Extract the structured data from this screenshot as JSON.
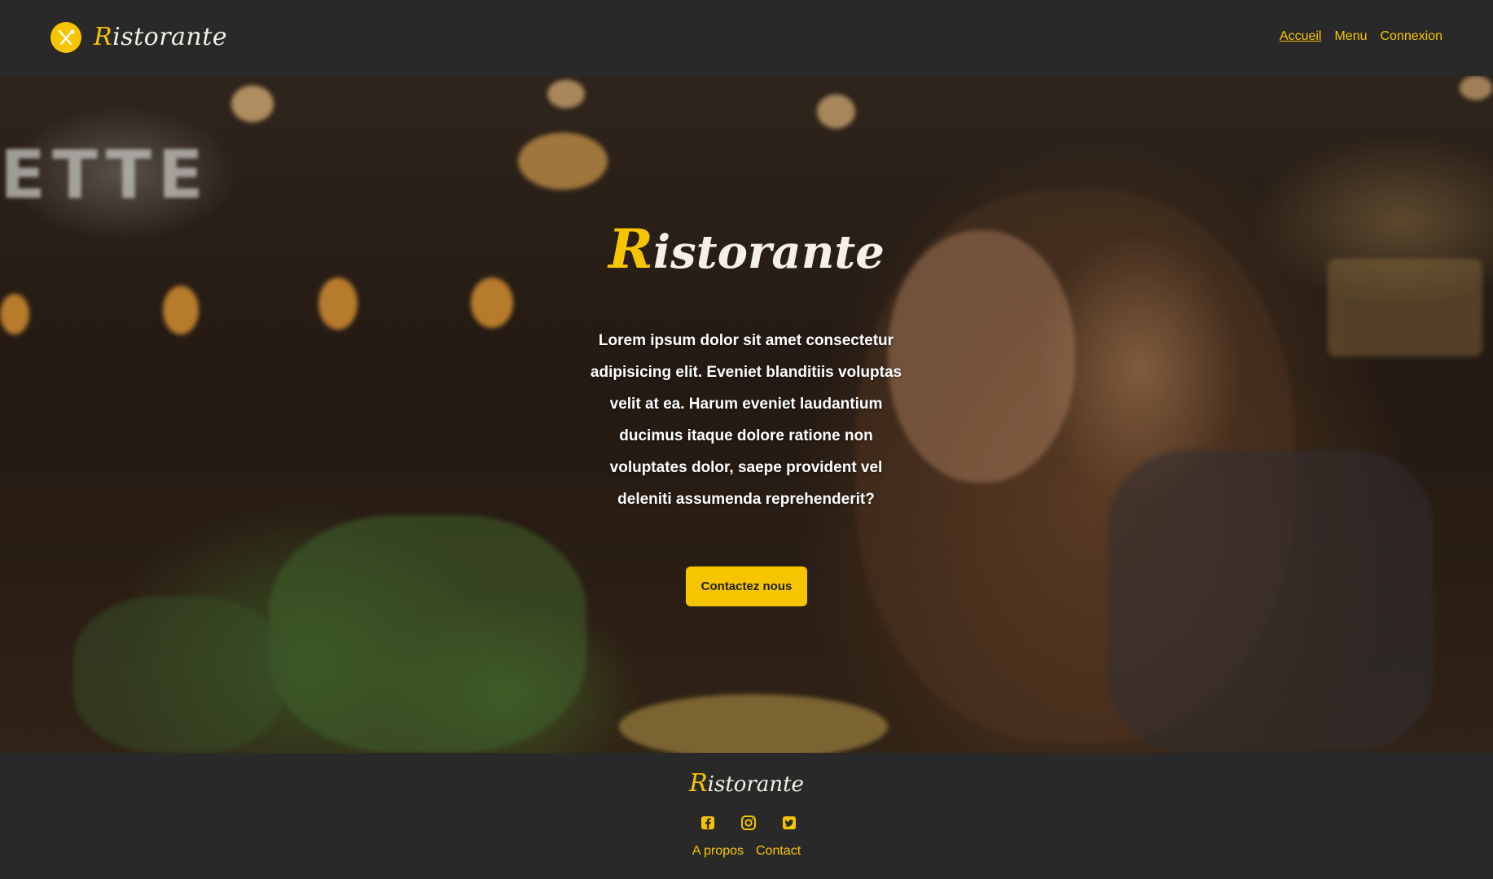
{
  "header": {
    "brand_initial": "R",
    "brand_rest": "istorante",
    "nav": {
      "home": "Accueil",
      "menu": "Menu",
      "login": "Connexion"
    }
  },
  "hero": {
    "title_initial": "R",
    "title_rest": "istorante",
    "body": "Lorem ipsum dolor sit amet consectetur adipisicing elit. Eveniet blanditiis voluptas velit at ea. Harum eveniet laudantium ducimus itaque dolore ratione non voluptates dolor, saepe provident vel deleniti assumenda reprehenderit?",
    "button": "Contactez nous",
    "signage_text": "ETTE"
  },
  "footer": {
    "brand_initial": "R",
    "brand_rest": "istorante",
    "socials": [
      "facebook-icon",
      "instagram-icon",
      "twitter-icon"
    ],
    "links": {
      "about": "A propos",
      "contact": "Contact"
    }
  },
  "colors": {
    "accent": "#f7c500",
    "dark": "#2a2929",
    "light_text": "#f3f0e6"
  }
}
